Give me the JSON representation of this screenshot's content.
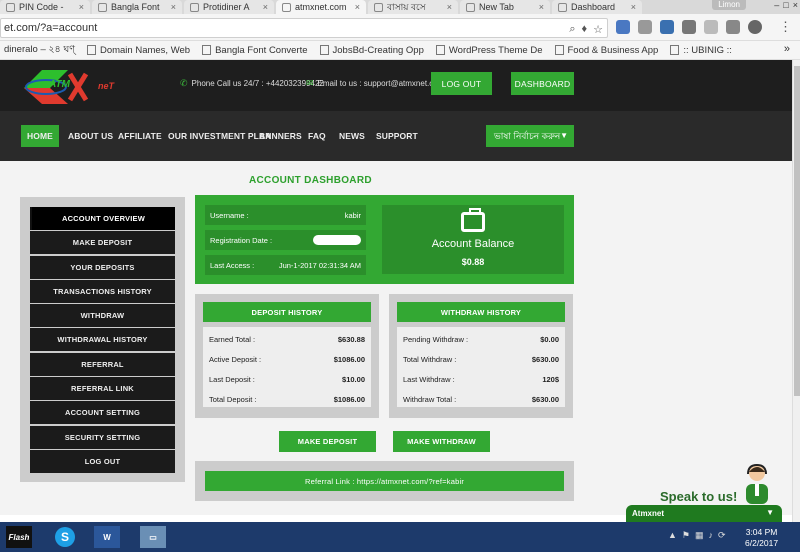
{
  "browser": {
    "tabs": [
      {
        "title": "PIN Code -",
        "active": false
      },
      {
        "title": "Bangla Font",
        "active": false
      },
      {
        "title": "Protidiner A",
        "active": false
      },
      {
        "title": "atmxnet.com",
        "active": true
      },
      {
        "title": "বাসায় বসে",
        "active": false
      },
      {
        "title": "New Tab",
        "active": false
      },
      {
        "title": "Dashboard",
        "active": false
      }
    ],
    "user_name": "Limon",
    "address": "et.com/?a=account",
    "bookmarks": [
      "dineralo – ২৪ ঘণ্",
      "Domain Names, Web",
      "Bangla Font Converte",
      "JobsBd-Creating Opp",
      "WordPress Theme De",
      "Food & Business App",
      ":: UBINIG ::"
    ],
    "bookmarks_more": "»"
  },
  "site": {
    "logo_text": "ATM",
    "logo_net": "neT",
    "phone_label": "Phone Call us 24/7 : +442032399422",
    "email_label": "Email to us : support@atmxnet.com",
    "logout_label": "LOG OUT",
    "dashboard_label": "DASHBOARD",
    "nav": [
      "HOME",
      "ABOUT US",
      "AFFILIATE",
      "OUR INVESTMENT PLAN",
      "BANNERS",
      "FAQ",
      "NEWS",
      "SUPPORT"
    ],
    "language_label": "ভাষা নির্বাচন করুন",
    "accent": "#33a833"
  },
  "dashboard": {
    "title": "ACCOUNT DASHBOARD",
    "sidebar": [
      "ACCOUNT OVERVIEW",
      "MAKE DEPOSIT",
      "YOUR DEPOSITS",
      "TRANSACTIONS HISTORY",
      "WITHDRAW",
      "WITHDRAWAL HISTORY",
      "REFERRAL",
      "REFERRAL LINK",
      "ACCOUNT SETTING",
      "SECURITY SETTING",
      "LOG OUT"
    ],
    "username_label": "Username :",
    "username_value": "kabir",
    "registration_label": "Registration Date :",
    "last_access_label": "Last Access :",
    "last_access_value": "Jun-1-2017 02:31:34 AM",
    "balance_label": "Account Balance",
    "balance_value": "$0.88",
    "deposit_history": {
      "title": "DEPOSIT HISTORY",
      "rows": [
        {
          "label": "Earned Total :",
          "value": "$630.88"
        },
        {
          "label": "Active Deposit :",
          "value": "$1086.00"
        },
        {
          "label": "Last Deposit :",
          "value": "$10.00"
        },
        {
          "label": "Total Deposit :",
          "value": "$1086.00"
        }
      ]
    },
    "withdraw_history": {
      "title": "WITHDRAW HISTORY",
      "rows": [
        {
          "label": "Pending Withdraw :",
          "value": "$0.00"
        },
        {
          "label": "Total Withdraw :",
          "value": "$630.00"
        },
        {
          "label": "Last Withdraw :",
          "value": "120$"
        },
        {
          "label": "Withdraw Total :",
          "value": "$630.00"
        }
      ]
    },
    "make_deposit_label": "MAKE DEPOSIT",
    "make_withdraw_label": "MAKE WITHDRAW",
    "referral_link": "Referral Link : https://atmxnet.com/?ref=kabir"
  },
  "chat": {
    "speak_label": "Speak to us!",
    "bar_label": "Atmxnet"
  },
  "taskbar": {
    "time": "3:04 PM",
    "date": "6/2/2017",
    "apps": [
      "Flash",
      "Skype",
      "Word",
      "Photos"
    ]
  }
}
